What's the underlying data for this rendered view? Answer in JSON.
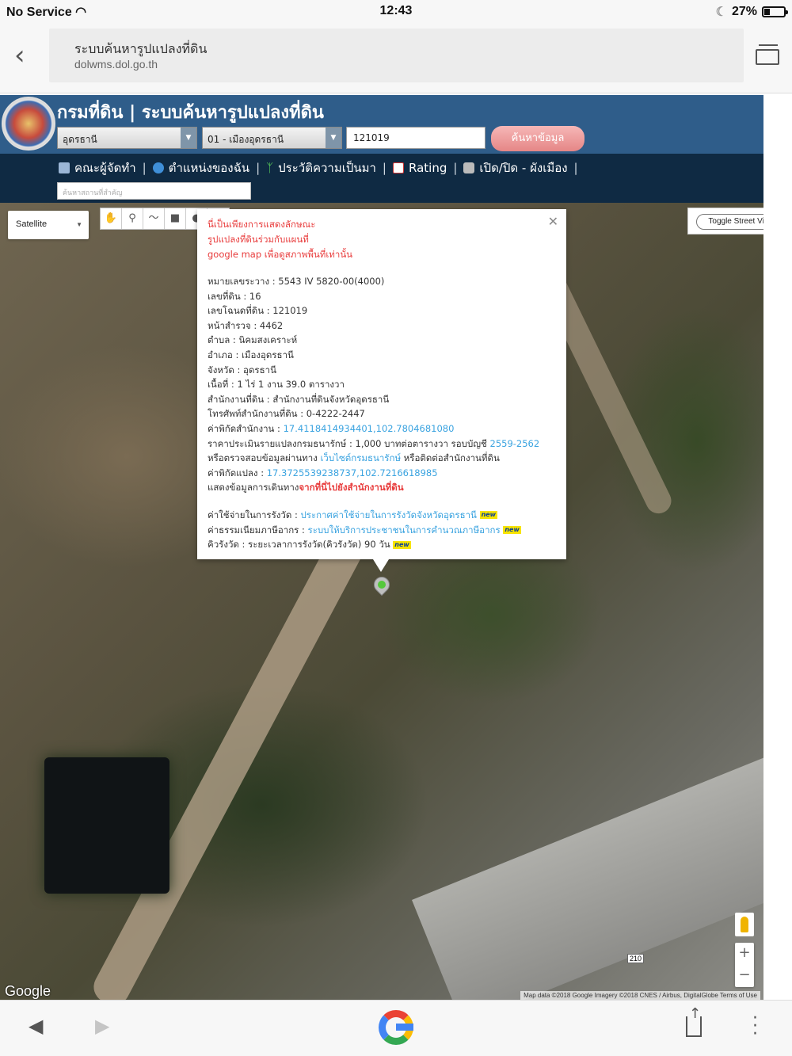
{
  "status_bar": {
    "carrier": "No Service",
    "time": "12:43",
    "battery": "27%"
  },
  "browser": {
    "page_title": "ระบบค้นหารูปแปลงที่ดิน",
    "domain": "dolwms.dol.go.th"
  },
  "header": {
    "title": "กรมที่ดิน | ระบบค้นหารูปแปลงที่ดิน",
    "province_select": "อุดรธานี",
    "district_select": "01 - เมืองอุดรธานี",
    "parcel_number": "121019",
    "search_button": "ค้นหาข้อมูล"
  },
  "nav": {
    "items": [
      "คณะผู้จัดทำ",
      "ตำแหน่งของฉัน",
      "ประวัติความเป็นมา",
      "Rating",
      "เปิด/ปิด - ผังเมือง"
    ],
    "agency_search_placeholder": "ค้นหาสถานที่สำคัญ"
  },
  "map": {
    "map_type": "Satellite",
    "toggle_street_view": "Toggle Street View",
    "google_logo": "Google",
    "copyright": "Map data ©2018 Google Imagery ©2018 CNES / Airbus, DigitalGlobe   Terms of Use",
    "road_shield": "210",
    "zoom_in": "+",
    "zoom_out": "−"
  },
  "info_window": {
    "warning": [
      "นี่เป็นเพียงการแสดงลักษณะ",
      "รูปแปลงที่ดินร่วมกับแผนที่",
      "google map เพื่อดูสภาพพื้นที่เท่านั้น"
    ],
    "map_sheet": "หมายเลขระวาง : 5543 IV 5820-00(4000)",
    "land_no": "เลขที่ดิน : 16",
    "deed_no": "เลขโฉนดที่ดิน : 121019",
    "survey_page": "หน้าสำรวจ : 4462",
    "subdistrict": "ตำบล : นิคมสงเคราะห์",
    "district": "อำเภอ : เมืองอุดรธานี",
    "province": "จังหวัด : อุดรธานี",
    "area": "เนื้อที่ : 1 ไร่ 1 งาน 39.0 ตารางวา",
    "land_office": "สำนักงานที่ดิน : สำนักงานที่ดินจังหวัดอุดรธานี",
    "office_phone": "โทรศัพท์สำนักงานที่ดิน : 0-4222-2447",
    "office_coord_label": "ค่าพิกัดสำนักงาน : ",
    "office_coord": "17.4118414934401,102.7804681080",
    "appraisal_label": "ราคาประเมินรายแปลงกรมธนารักษ์ : 1,000 บาทต่อตารางวา รอบบัญชี ",
    "appraisal_period": "2559-2562",
    "verify_prefix": "หรือตรวจสอบข้อมูลผ่านทาง ",
    "verify_link": "เว็บไซต์กรมธนารักษ์",
    "verify_suffix": " หรือติดต่อสำนักงานที่ดิน",
    "parcel_coord_label": "ค่าพิกัดแปลง : ",
    "parcel_coord": "17.3725539238737,102.7216618985",
    "route_label": "แสดงข้อมูลการเดินทาง",
    "route_link": "จากที่นี่ไปยังสำนักงานที่ดิน",
    "survey_fee_label": "ค่าใช้จ่ายในการรังวัด : ",
    "survey_fee_link": "ประกาศค่าใช้จ่ายในการรังวัดจังหวัดอุดรธานี",
    "tax_label": "ค่าธรรมเนียมภาษีอากร : ",
    "tax_link": "ระบบให้บริการประชาชนในการคำนวณภาษีอากร",
    "queue_label": "คิวรังวัด : ระยะเวลาการรังวัด(คิวรังวัด) 90 วัน",
    "new_badge": "new"
  }
}
